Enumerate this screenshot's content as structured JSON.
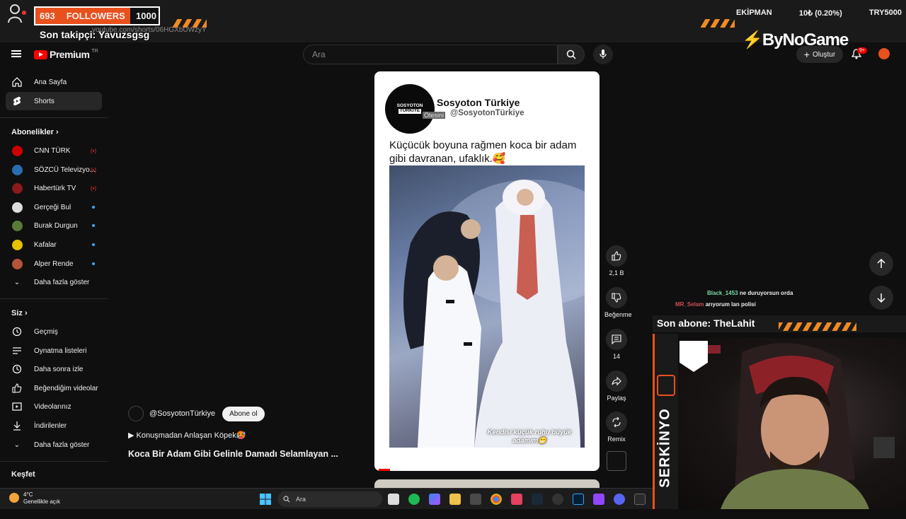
{
  "overlay": {
    "followers_count": "693",
    "followers_label": "FOLLOWERS",
    "followers_goal": "1000",
    "last_follower": "Son takipçi: Yavuzsgsg",
    "url": "youtube.com/shorts/06HGXbUWzyY",
    "stats_label": "EKİPMAN",
    "stats_change": "10₺ (0.20%)",
    "stats_ticker": "TRY5000",
    "sponsor": "ByNoGame",
    "last_subscriber": "Son abone: TheLahit",
    "streamer_name": "SERKİNYO",
    "chat": [
      {
        "user": "Black_1453",
        "message": "ne duruyorsun orda",
        "color": "#7ad9a8"
      },
      {
        "user": "MR_Selam",
        "message": "arıyorum lan polisi",
        "color": "#d14b5a"
      }
    ]
  },
  "header": {
    "logo_text": "Premium",
    "logo_region": "TR",
    "search_placeholder": "Ara",
    "create_label": "Oluştur",
    "notification_badge": "9+"
  },
  "sidebar": {
    "main": [
      {
        "label": "Ana Sayfa",
        "icon": "home-icon"
      },
      {
        "label": "Shorts",
        "icon": "shorts-icon",
        "active": true
      }
    ],
    "subscriptions_title": "Abonelikler",
    "subscriptions": [
      {
        "label": "CNN TÜRK",
        "status": "live",
        "color": "#c00"
      },
      {
        "label": "SÖZCÜ Televizyo...",
        "status": "live",
        "color": "#2b6cb0"
      },
      {
        "label": "Habertürk TV",
        "status": "live",
        "color": "#8b1a1a"
      },
      {
        "label": "Gerçeği Bul",
        "status": "new",
        "color": "#ddd"
      },
      {
        "label": "Burak Durgun",
        "status": "new",
        "color": "#5a7a3a"
      },
      {
        "label": "Kafalar",
        "status": "new",
        "color": "#e6c200"
      },
      {
        "label": "Alper Rende",
        "status": "new",
        "color": "#b5543a"
      }
    ],
    "subscriptions_more": "Daha fazla göster",
    "you_title": "Siz",
    "you": [
      {
        "label": "Geçmiş",
        "icon": "history-icon"
      },
      {
        "label": "Oynatma listeleri",
        "icon": "playlist-icon"
      },
      {
        "label": "Daha sonra izle",
        "icon": "clock-icon"
      },
      {
        "label": "Beğendiğim videolar",
        "icon": "thumbs-up-icon"
      },
      {
        "label": "Videolarınız",
        "icon": "video-icon"
      },
      {
        "label": "İndirilenler",
        "icon": "download-icon"
      }
    ],
    "you_more": "Daha fazla göster",
    "explore_title": "Keşfet"
  },
  "short": {
    "account_logo_line1": "SOSYOTON",
    "account_logo_line2": "TÜRKİYE",
    "account_name": "Sosyoton Türkiye",
    "account_handle": "@SosyotonTürkiye",
    "tooltip": "Ötesini",
    "caption": "Küçücük boyuna rağmen koca bir adam gibi davranan, ufaklık.🥰",
    "photo_text": "Kendisi küçük ruhu büyük adamım😁",
    "channel_handle": "@SosyotonTürkiye",
    "subscribe_label": "Abone ol",
    "description": "▶ Konuşmadan Anlaşan Köpek🥵",
    "title": "Koca Bir Adam Gibi Gelinle Damadı Selamlayan ..."
  },
  "actions": {
    "like_count": "2,1 B",
    "dislike_label": "Beğenme",
    "comment_count": "14",
    "share_label": "Paylaş",
    "remix_label": "Remix"
  },
  "taskbar": {
    "temperature": "4°C",
    "weather_desc": "Genellikle açık",
    "search_placeholder": "Ara"
  }
}
